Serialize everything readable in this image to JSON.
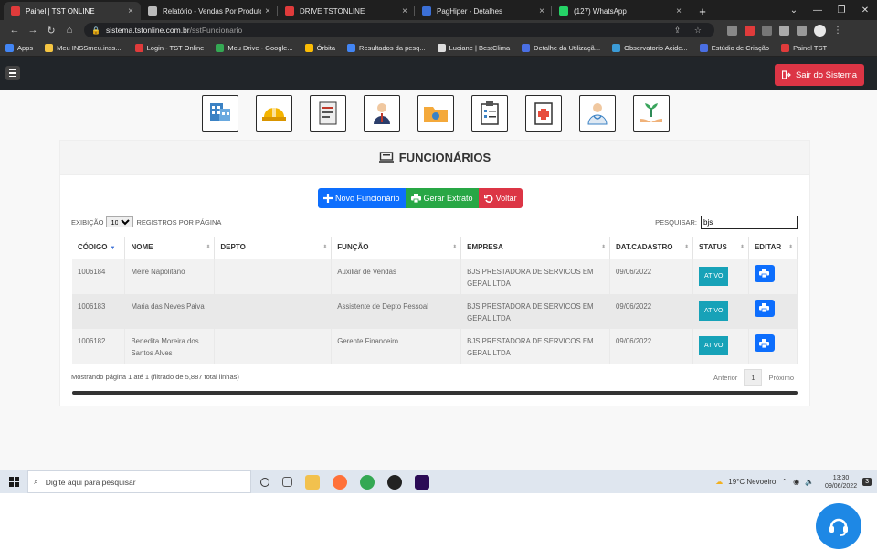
{
  "browser": {
    "tabs": [
      {
        "title": "Painel | TST ONLINE",
        "active": true,
        "color": "#e03b3b"
      },
      {
        "title": "Relatório - Vendas Por Produto",
        "active": false,
        "color": "#bbbbbb"
      },
      {
        "title": "DRIVE TSTONLINE",
        "active": false,
        "color": "#e03b3b"
      },
      {
        "title": "PagHiper - Detalhes",
        "active": false,
        "color": "#3b6fd6"
      },
      {
        "title": "(127) WhatsApp",
        "active": false,
        "color": "#25d366"
      }
    ],
    "url_host": "sistema.tstonline.com.br",
    "url_path": "/sstFuncionario",
    "bookmarks": [
      {
        "label": "Apps",
        "color": "#4285f4"
      },
      {
        "label": "Meu INSSmeu.inss....",
        "color": "#f5c542"
      },
      {
        "label": "Login - TST Online",
        "color": "#e03b3b"
      },
      {
        "label": "Meu Drive - Google...",
        "color": "#34a853"
      },
      {
        "label": "Órbita",
        "color": "#fbbc05"
      },
      {
        "label": "Resultados da pesq...",
        "color": "#4285f4"
      },
      {
        "label": "Luciane | BestClima",
        "color": "#dddddd"
      },
      {
        "label": "Detalhe da Utilizaçã...",
        "color": "#4a6fe3"
      },
      {
        "label": "Observatorio Acide...",
        "color": "#3b9bd6"
      },
      {
        "label": "Estúdio de Criação",
        "color": "#4a6fe3"
      },
      {
        "label": "Painel TST",
        "color": "#e03b3b"
      }
    ]
  },
  "app": {
    "logout_label": "Sair do Sistema",
    "shortcut_icons": [
      "building-icon",
      "helmet-icon",
      "document-icon",
      "worker-icon",
      "folder-icon",
      "clipboard-icon",
      "medical-report-icon",
      "doctor-icon",
      "plant-hands-icon"
    ],
    "title": "FUNCIONÁRIOS",
    "buttons": {
      "new": "Novo Funcionário",
      "extract": "Gerar Extrato",
      "back": "Voltar"
    },
    "length": {
      "prefix": "EXIBIÇÃO",
      "value": "10",
      "suffix": "REGISTROS POR PÁGINA"
    },
    "search": {
      "label": "PESQUISAR:",
      "value": "bjs"
    },
    "columns": [
      "CÓDIGO",
      "NOME",
      "DEPTO",
      "FUNÇÃO",
      "EMPRESA",
      "DAT.CADASTRO",
      "STATUS",
      "EDITAR"
    ],
    "rows": [
      {
        "codigo": "1006184",
        "nome": "Meire Napolitano",
        "depto": "",
        "funcao": "Auxiliar de Vendas",
        "empresa": "BJS PRESTADORA DE SERVICOS EM GERAL LTDA",
        "data": "09/06/2022",
        "status": "ATIVO"
      },
      {
        "codigo": "1006183",
        "nome": "Maria das Neves Paiva",
        "depto": "",
        "funcao": "Assistente de Depto Pessoal",
        "empresa": "BJS PRESTADORA DE SERVICOS EM GERAL LTDA",
        "data": "09/06/2022",
        "status": "ATIVO"
      },
      {
        "codigo": "1006182",
        "nome": "Benedita Moreira dos Santos Alves",
        "depto": "",
        "funcao": "Gerente Financeiro",
        "empresa": "BJS PRESTADORA DE SERVICOS EM GERAL LTDA",
        "data": "09/06/2022",
        "status": "ATIVO"
      }
    ],
    "footer_info": "Mostrando página 1 até 1 (filtrado de 5,887 total linhas)",
    "pagination": {
      "prev": "Anterior",
      "current": "1",
      "next": "Próximo"
    }
  },
  "taskbar": {
    "search_placeholder": "Digite aqui para pesquisar",
    "weather": "19°C Nevoeiro",
    "time": "13:30",
    "date": "09/06/2022",
    "notifications": "3"
  },
  "colors": {
    "primary": "#0d6efd",
    "success": "#28a745",
    "danger": "#dc3545",
    "info": "#17a2b8"
  }
}
